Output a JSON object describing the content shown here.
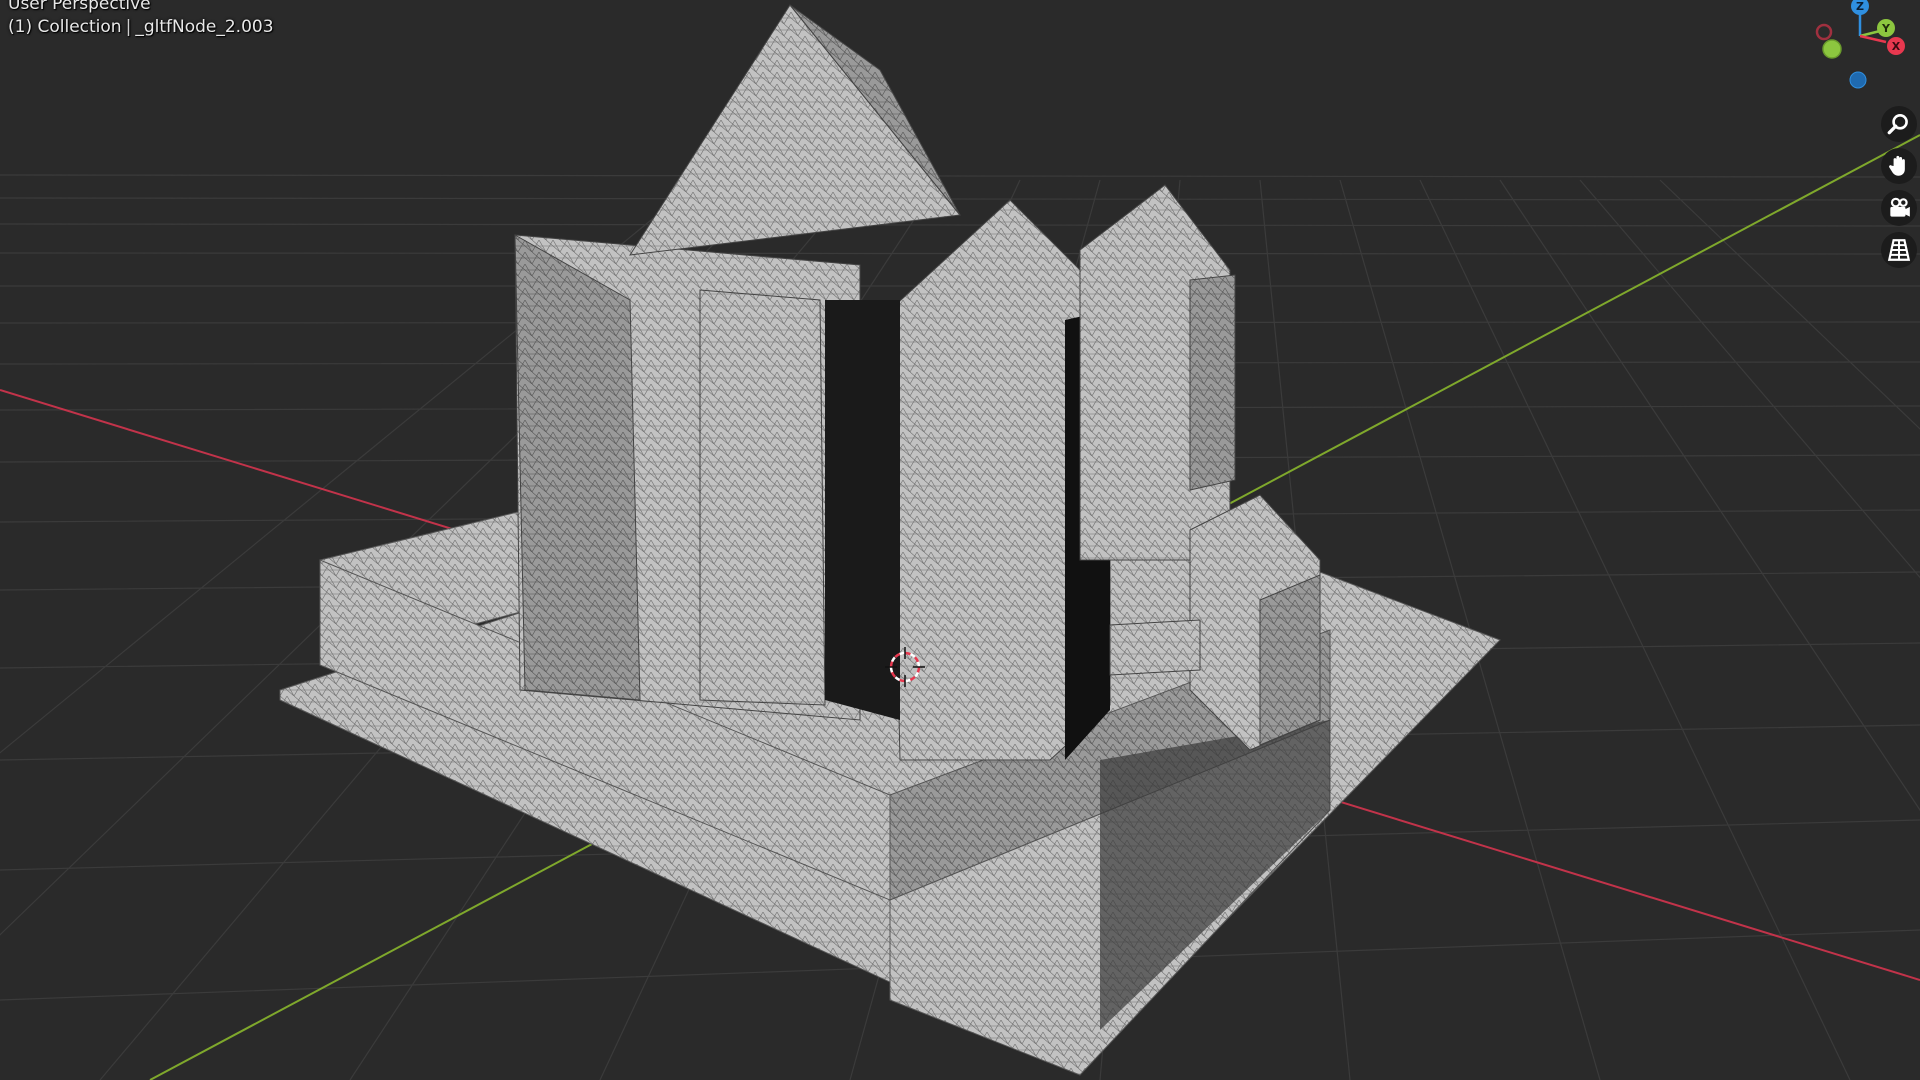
{
  "viewport": {
    "view_name": "User Perspective",
    "collection_prefix": "(1) Collection",
    "separator": "|",
    "object_name": "_gltfNode_2.003"
  },
  "gizmo": {
    "z_label": "Z",
    "y_label": "Y",
    "x_label": "X",
    "colors": {
      "x": "#e8384f",
      "y": "#8cc63f",
      "z": "#2f8fe0"
    }
  },
  "navigation": {
    "zoom_icon": "magnifier-icon",
    "pan_icon": "hand-icon",
    "camera_icon": "camera-icon",
    "ortho_icon": "grid-perspective-icon"
  },
  "colors": {
    "background": "#2a2a2a",
    "grid": "#3a3a3a",
    "x_axis": "#c2334a",
    "y_axis": "#7fa82c",
    "mesh": "#b9b9b9"
  }
}
